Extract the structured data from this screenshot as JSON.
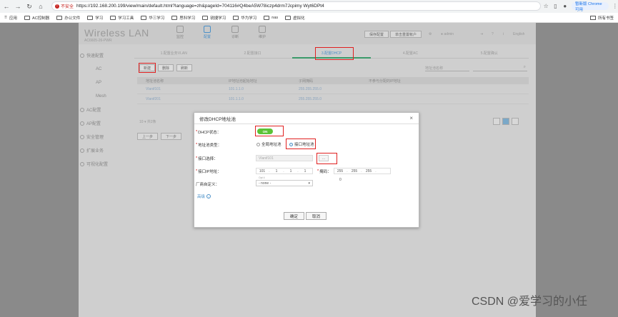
{
  "browser": {
    "insecure_label": "不安全",
    "url": "https://192.168.200.199/view/main/default.html?language=zh&pageId=704116#Q4beA5W78iczp4drm7Jcpimy Wyt6DPt4",
    "profile_label": "暂新版 Chrome 可用",
    "bookmarks": [
      "应用",
      "AC控制器",
      "办公文件",
      "学习",
      "学习工具",
      "华三学习",
      "思科学习",
      "锐捷学习",
      "华为学习",
      "nas",
      "虚拟化"
    ],
    "bookmarks_all": "所有书签"
  },
  "app": {
    "brand": "Wireless LAN",
    "model": "AC6605-26-PWR",
    "topnav": [
      "监控",
      "配置",
      "诊断",
      "维护"
    ],
    "header_buttons": [
      "保存配置",
      "单击重置帐户"
    ],
    "user": "admin",
    "language": "English",
    "sidebar": [
      {
        "label": "快速配置",
        "sub": [
          "AC",
          "AP",
          "Mesh"
        ]
      },
      {
        "label": "AC配置"
      },
      {
        "label": "AP配置"
      },
      {
        "label": "安全管理"
      },
      {
        "label": "扩展业务"
      },
      {
        "label": "可视化配置"
      }
    ],
    "steps": [
      "1.配置业务VLAN",
      "2.配置接口",
      "3.配置DHCP",
      "4.配置AC",
      "5.配置确认"
    ],
    "toolbar": [
      "新建",
      "删除",
      "刷新"
    ],
    "search_placeholder": "地址池名称",
    "table": {
      "headers": [
        "地址池名称",
        "IP地址池起始地址",
        "子网掩码",
        "不参与分配的IP地址"
      ],
      "rows": [
        [
          "Vlanif101",
          "101.1.1.0",
          "255.255.255.0",
          ""
        ],
        [
          "Vlanif201",
          "101.1.1.0",
          "255.255.255.0",
          ""
        ]
      ]
    },
    "pager_text": "10 ▾ 共2条",
    "prev": "上一步",
    "next": "下一步"
  },
  "modal": {
    "title": "修改DHCP地址池",
    "dhcp_state_label": "DHCP状态：",
    "dhcp_state_value": "ON",
    "pool_type_label": "地址池类型：",
    "pool_type_options": [
      "全局地址池",
      "接口地址池"
    ],
    "iface_label": "接口选择：",
    "iface_value": "Vlanif101",
    "dots": "...",
    "ip_label": "接口IP地址：",
    "ip": [
      "101",
      "1",
      "1",
      "1"
    ],
    "mask_label": "掩码：",
    "mask": [
      "255",
      "255",
      "255",
      ""
    ],
    "zero": "0",
    "vendor_label": "厂商自定义：",
    "vendor_note": "Opt 4",
    "vendor_value": "- none -",
    "advanced": "高级",
    "ok": "确定",
    "cancel": "取消"
  },
  "watermark": "CSDN @爱学习的小任"
}
